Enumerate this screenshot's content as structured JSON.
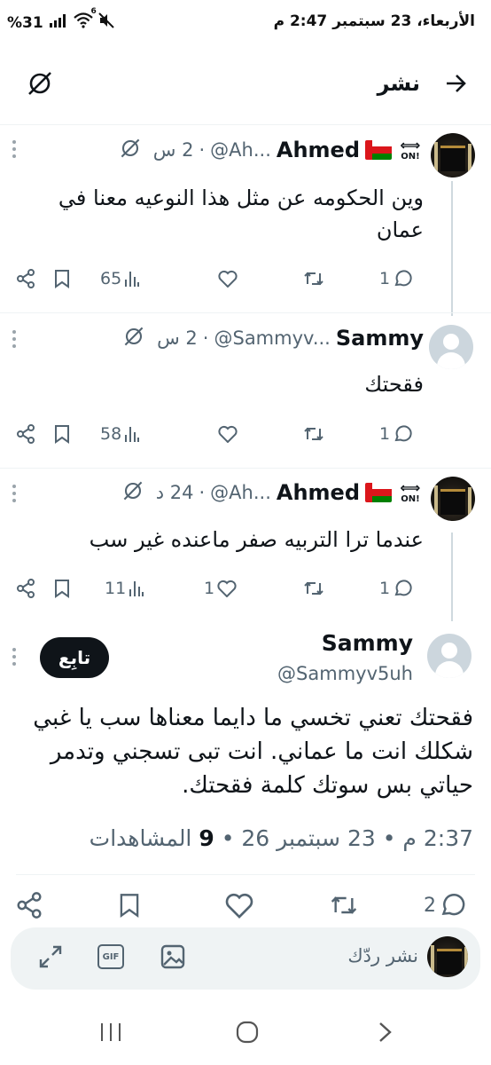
{
  "status_bar": {
    "time": "2:47",
    "ampm": "م",
    "date": "الأربعاء، 23 سبتمبر",
    "battery": "31",
    "battery_unit": "%",
    "signal_label": "6"
  },
  "header": {
    "title": "نشر"
  },
  "replies": [
    {
      "name": "Ahmed",
      "handle": "@Ah...",
      "time": "2 س",
      "dot": "·",
      "badge": "ON!",
      "text_line1": "وين الحكومه عن مثل هذا النوعيه معنا في",
      "text_line2": "عمان",
      "replies_count": "1",
      "views_count": "65"
    },
    {
      "name": "Sammy",
      "handle": "@Sammyv...",
      "time": "2 س",
      "dot": "·",
      "text": "فقحتك",
      "replies_count": "1",
      "views_count": "58"
    },
    {
      "name": "Ahmed",
      "handle": "@Ah...",
      "time": "24 د",
      "dot": "·",
      "badge": "ON!",
      "text": "عندما ترا التربيه صفر  ماعنده غير سب",
      "replies_count": "1",
      "likes_count": "1",
      "views_count": "11"
    }
  ],
  "main_tweet": {
    "name": "Sammy",
    "handle": "@Sammyv5uh",
    "follow_label": "تابِع",
    "text_line1": "فقحتك تعني تخسي ما دايما معناها سب يا غبي",
    "text_line2": "شكلك انت ما عماني. انت تبى تسجني وتدمر",
    "text_line3": "حياتي بس سوتك كلمة فقحتك.",
    "time": "2:37 م",
    "date": "23 سبتمبر 26",
    "views": "9",
    "views_label": "المشاهدات",
    "sep": "•",
    "replies_count": "2"
  },
  "reply_box": {
    "placeholder": "نشر ردّك",
    "gif_label": "GIF"
  }
}
